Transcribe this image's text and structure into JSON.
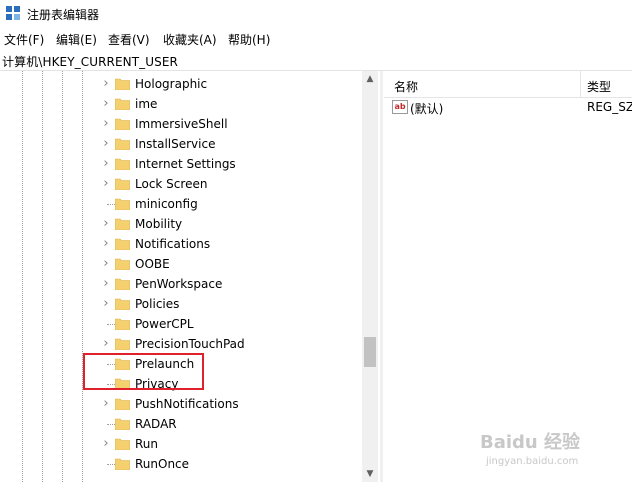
{
  "window": {
    "title": "注册表编辑器"
  },
  "menu": [
    "文件(F)",
    "编辑(E)",
    "查看(V)",
    "收藏夹(A)",
    "帮助(H)"
  ],
  "address": "计算机\\HKEY_CURRENT_USER",
  "tree_items": [
    {
      "label": "Holographic",
      "expandable": true
    },
    {
      "label": "ime",
      "expandable": true
    },
    {
      "label": "ImmersiveShell",
      "expandable": true
    },
    {
      "label": "InstallService",
      "expandable": true
    },
    {
      "label": "Internet Settings",
      "expandable": true
    },
    {
      "label": "Lock Screen",
      "expandable": true
    },
    {
      "label": "miniconfig",
      "expandable": false
    },
    {
      "label": "Mobility",
      "expandable": true
    },
    {
      "label": "Notifications",
      "expandable": true
    },
    {
      "label": "OOBE",
      "expandable": true
    },
    {
      "label": "PenWorkspace",
      "expandable": true
    },
    {
      "label": "Policies",
      "expandable": true,
      "highlighted": true
    },
    {
      "label": "PowerCPL",
      "expandable": false
    },
    {
      "label": "PrecisionTouchPad",
      "expandable": true
    },
    {
      "label": "Prelaunch",
      "expandable": false
    },
    {
      "label": "Privacy",
      "expandable": false
    },
    {
      "label": "PushNotifications",
      "expandable": true
    },
    {
      "label": "RADAR",
      "expandable": false
    },
    {
      "label": "Run",
      "expandable": true
    },
    {
      "label": "RunOnce",
      "expandable": false
    }
  ],
  "list": {
    "columns": {
      "name": "名称",
      "type": "类型"
    },
    "rows": [
      {
        "name": "(默认)",
        "type": "REG_SZ",
        "icon": "string-value-icon"
      }
    ]
  },
  "colors": {
    "folder": "#f4d06f",
    "highlight": "#e0212b",
    "icon_blue": "#2b6ebd"
  },
  "watermark": {
    "main": "Baidu 经验",
    "sub": "jingyan.baidu.com"
  }
}
